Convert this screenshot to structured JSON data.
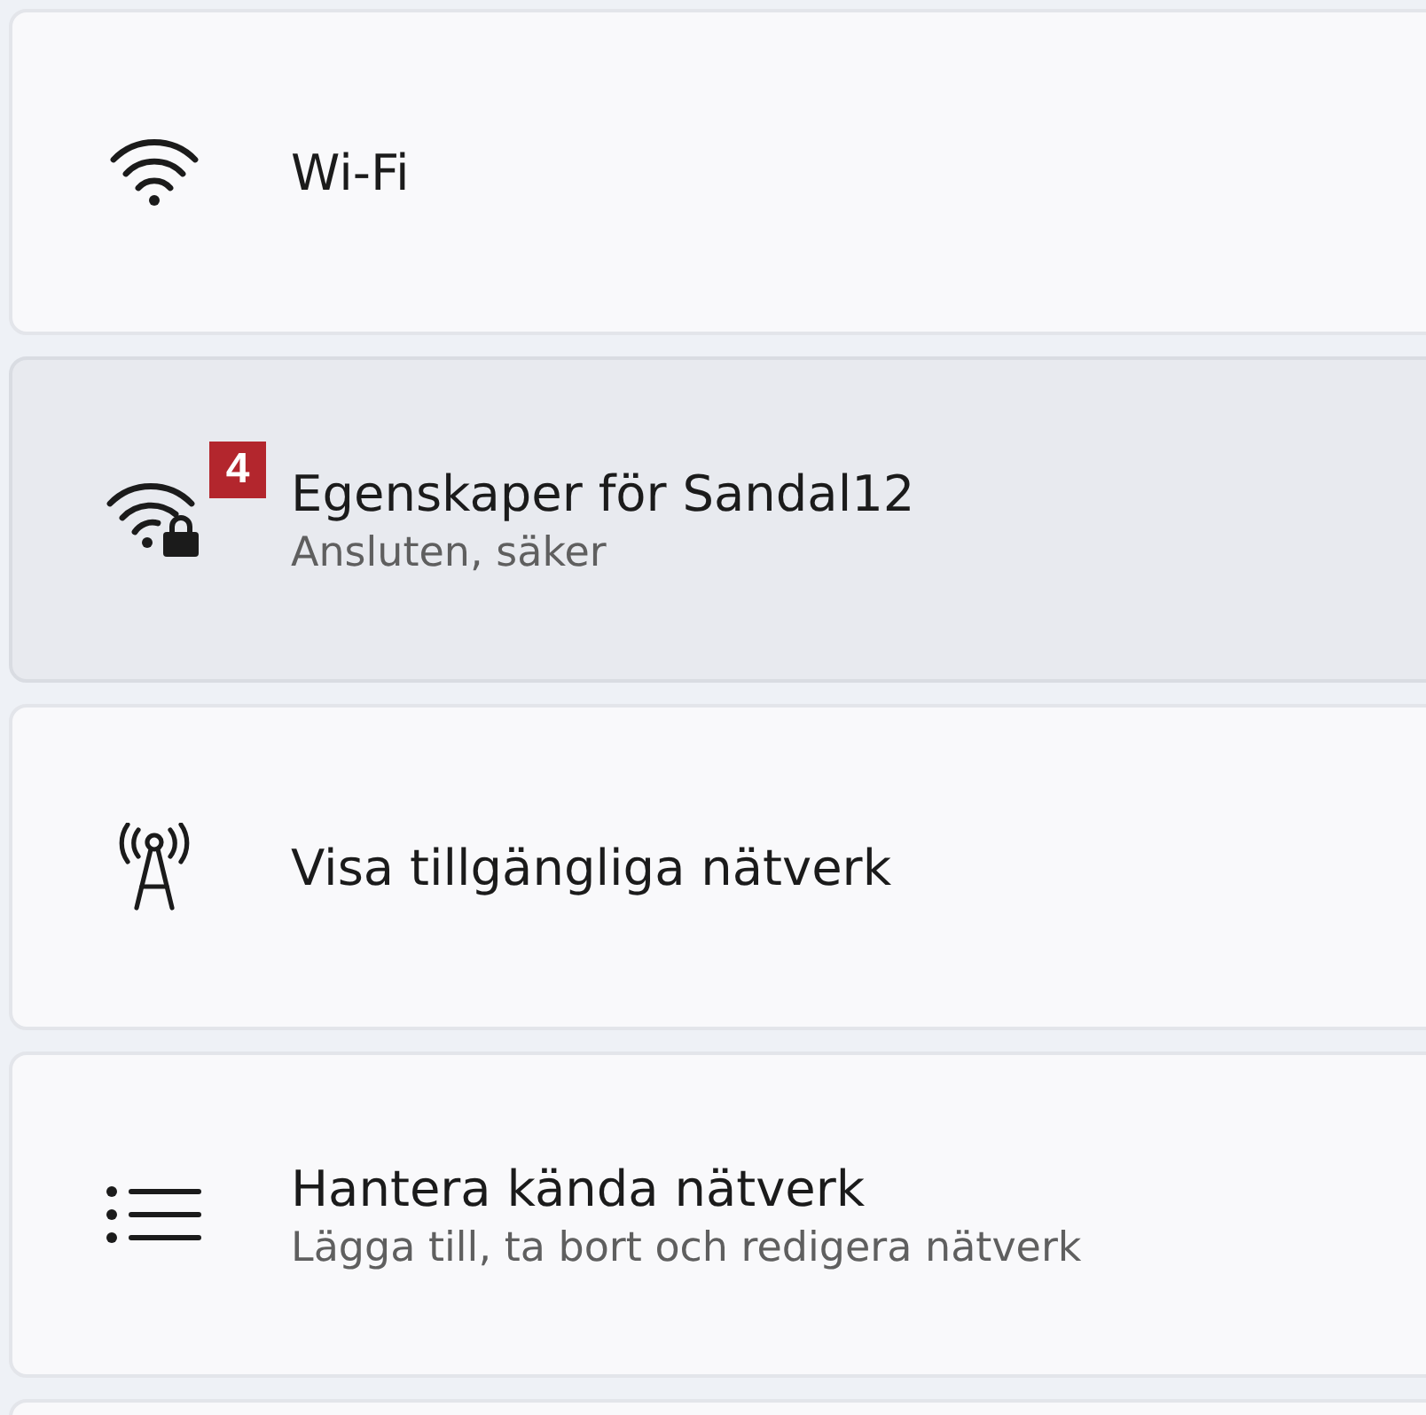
{
  "items": [
    {
      "kind": "wifi",
      "title": "Wi-Fi",
      "hovered": false
    },
    {
      "kind": "wifi-lock",
      "title": "Egenskaper för Sandal12",
      "subtitle": "Ansluten, säker",
      "badge": "4",
      "hovered": true
    },
    {
      "kind": "antenna",
      "title": "Visa tillgängliga nätverk",
      "hovered": false
    },
    {
      "kind": "list",
      "title": "Hantera kända nätverk",
      "subtitle": "Lägga till, ta bort och redigera nätverk",
      "hovered": false
    }
  ]
}
